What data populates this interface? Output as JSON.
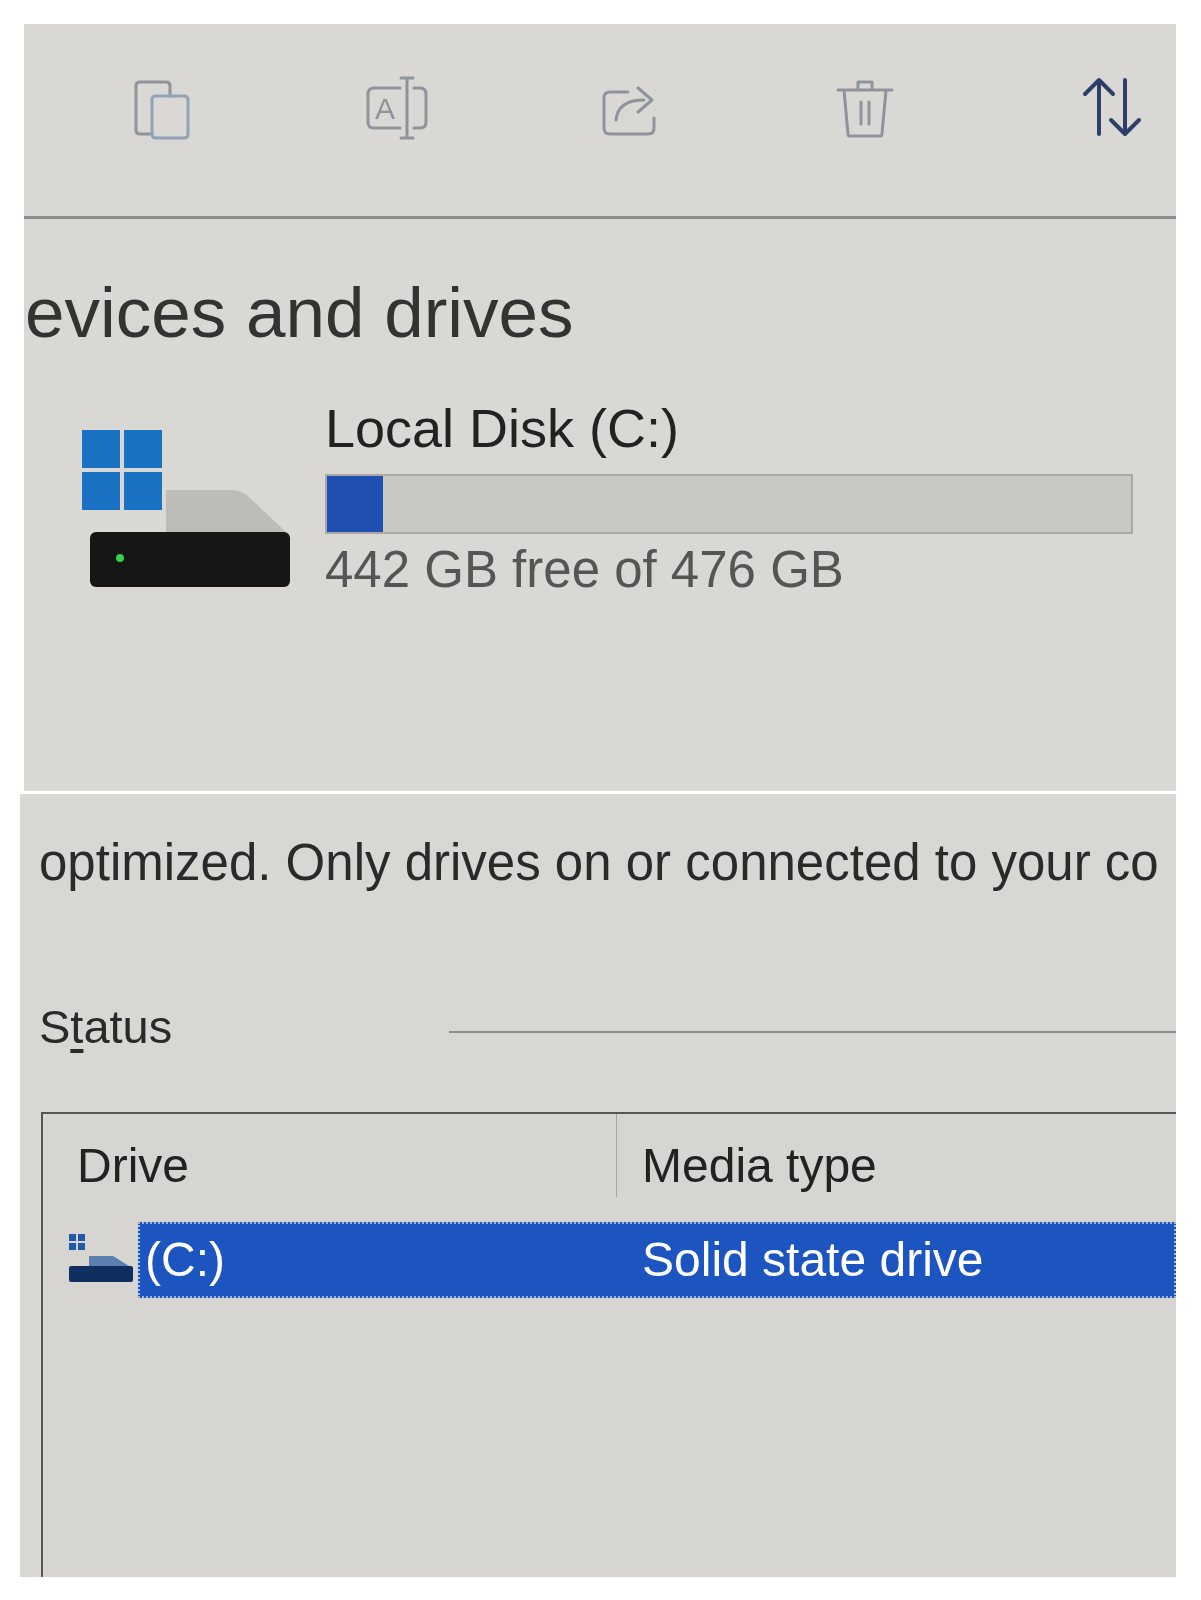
{
  "toolbar": [
    {
      "disabled": true
    },
    {
      "glyph": "A",
      "disabled": true
    },
    {
      "disabled": true
    },
    {
      "disabled": true
    },
    {
      "disabled": false
    }
  ],
  "devices": {
    "heading": "evices and drives",
    "drives": [
      {
        "name": "Local Disk (C:)",
        "level": 0.07,
        "free_text": "442 GB free of 476 GB"
      }
    ]
  },
  "optimize": {
    "description": "optimized. Only drives on or connected to your co",
    "status": {
      "label_parts": [
        {
          "text": "S",
          "underlined": false
        },
        {
          "text": "t",
          "underlined": true
        },
        {
          "text": "atus",
          "underlined": false
        }
      ]
    },
    "table": {
      "columns": [
        "Drive",
        "Media type"
      ],
      "rows": [
        {
          "drive": "(C:)",
          "media_type": "Solid state drive",
          "selected": true
        }
      ]
    }
  }
}
